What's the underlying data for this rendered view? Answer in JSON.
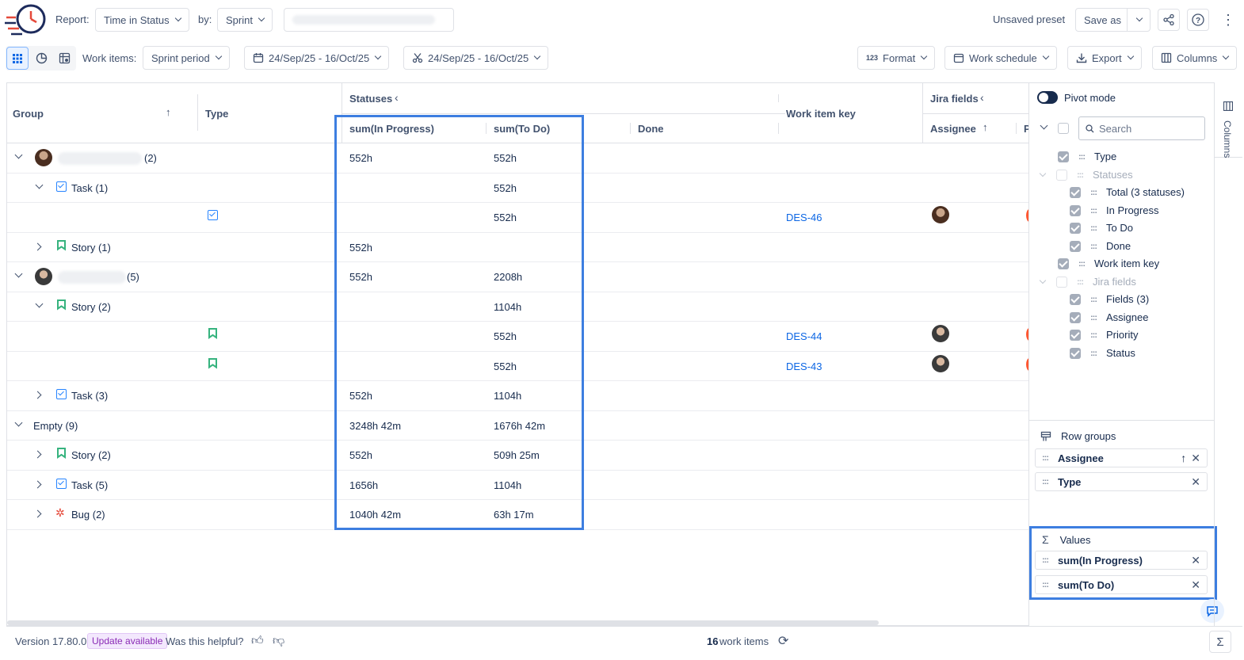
{
  "toolbar": {
    "report_label": "Report:",
    "report_value": "Time in Status",
    "by_label": "by:",
    "by_value": "Sprint",
    "preset_status": "Unsaved preset",
    "save_as": "Save as"
  },
  "toolbar2": {
    "work_items_label": "Work items:",
    "work_items_value": "Sprint period",
    "date_range_1": "24/Sep/25 - 16/Oct/25",
    "date_range_2": "24/Sep/25 - 16/Oct/25",
    "format": "Format",
    "format_icon": "123",
    "work_schedule": "Work schedule",
    "export": "Export",
    "columns": "Columns"
  },
  "grid": {
    "headers": {
      "group": "Group",
      "type": "Type",
      "statuses": "Statuses",
      "in_progress": "sum(In Progress)",
      "to_do": "sum(To Do)",
      "done": "Done",
      "work_item_key": "Work item key",
      "jira_fields": "Jira fields",
      "assignee": "Assignee",
      "p": "P"
    },
    "rows": [
      {
        "group": "(2)",
        "in_progress": "552h",
        "to_do": "552h",
        "key": ""
      },
      {
        "group": "Task (1)",
        "in_progress": "",
        "to_do": "552h",
        "key": ""
      },
      {
        "group": "",
        "in_progress": "",
        "to_do": "552h",
        "key": "DES-46"
      },
      {
        "group": "Story (1)",
        "in_progress": "552h",
        "to_do": "",
        "key": ""
      },
      {
        "group": "(5)",
        "in_progress": "552h",
        "to_do": "2208h",
        "key": ""
      },
      {
        "group": "Story (2)",
        "in_progress": "",
        "to_do": "1104h",
        "key": ""
      },
      {
        "group": "",
        "in_progress": "",
        "to_do": "552h",
        "key": "DES-44"
      },
      {
        "group": "",
        "in_progress": "",
        "to_do": "552h",
        "key": "DES-43"
      },
      {
        "group": "Task (3)",
        "in_progress": "552h",
        "to_do": "1104h",
        "key": ""
      },
      {
        "group": "Empty (9)",
        "in_progress": "3248h 42m",
        "to_do": "1676h 42m",
        "key": ""
      },
      {
        "group": "Story (2)",
        "in_progress": "552h",
        "to_do": "509h 25m",
        "key": ""
      },
      {
        "group": "Task (5)",
        "in_progress": "1656h",
        "to_do": "1104h",
        "key": ""
      },
      {
        "group": "Bug (2)",
        "in_progress": "1040h 42m",
        "to_do": "63h 17m",
        "key": ""
      }
    ]
  },
  "panel": {
    "pivot_mode": "Pivot mode",
    "search_placeholder": "Search",
    "columns_list": [
      "Type",
      "Statuses",
      "Total (3 statuses)",
      "In Progress",
      "To Do",
      "Done",
      "Work item key",
      "Jira fields",
      "Fields (3)",
      "Assignee",
      "Priority",
      "Status"
    ],
    "row_groups_label": "Row groups",
    "row_groups": [
      "Assignee",
      "Type"
    ],
    "values_label": "Values",
    "values": [
      "sum(In Progress)",
      "sum(To Do)"
    ],
    "side_tab": "Columns"
  },
  "footer": {
    "version": "Version 17.80.0",
    "update": "Update available",
    "helpful": "Was this helpful?",
    "count": "16",
    "count_label": "work items"
  },
  "colors": {
    "highlight": "#3d7ee0",
    "link": "#0c66e4",
    "update_badge_bg": "#f3e8fd",
    "update_badge_text": "#8a2bb5"
  }
}
